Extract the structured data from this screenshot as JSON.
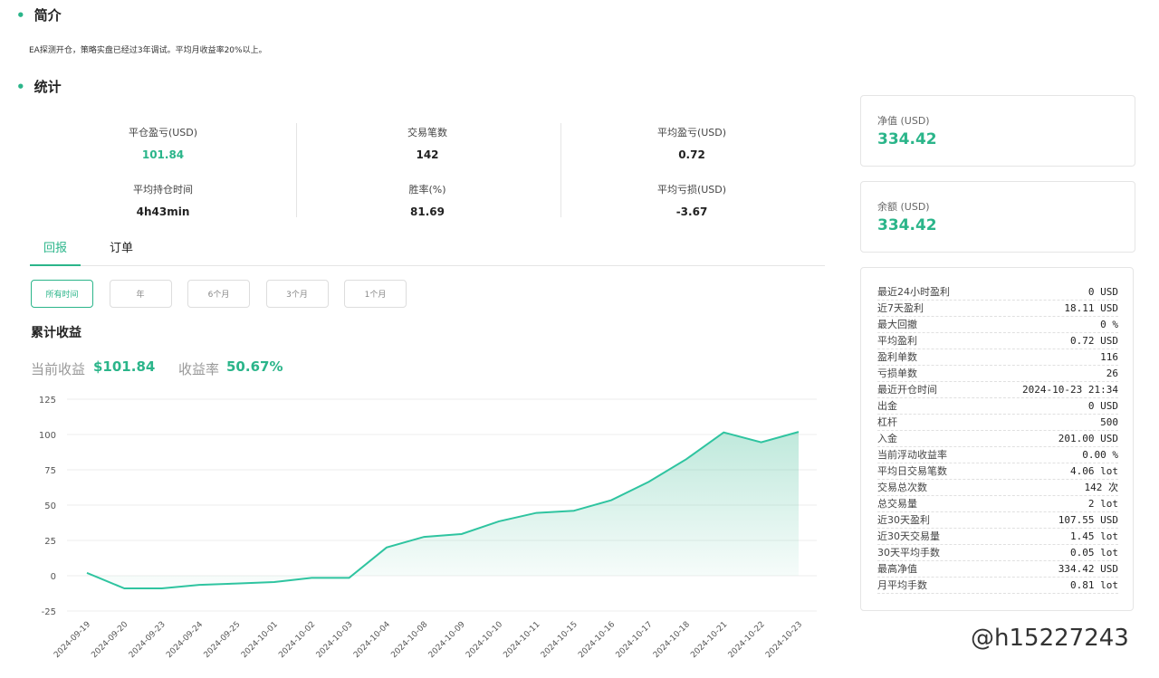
{
  "intro": {
    "title": "简介",
    "text": "EA探测开仓，策略实盘已经过3年调试。平均月收益率20%以上。"
  },
  "stats": {
    "title": "统计",
    "items": [
      {
        "label": "平仓盈亏(USD)",
        "value": "101.84",
        "green": true
      },
      {
        "label": "交易笔数",
        "value": "142"
      },
      {
        "label": "平均盈亏(USD)",
        "value": "0.72"
      },
      {
        "label": "平均持仓时间",
        "value": "4h43min"
      },
      {
        "label": "胜率(%)",
        "value": "81.69"
      },
      {
        "label": "平均亏损(USD)",
        "value": "-3.67"
      }
    ]
  },
  "tabs": [
    "回报",
    "订单"
  ],
  "ranges": [
    "所有时间",
    "年",
    "6个月",
    "3个月",
    "1个月"
  ],
  "chart_title": "累计收益",
  "summary": {
    "current_label": "当前收益",
    "current_value": "$101.84",
    "rate_label": "收益率",
    "rate_value": "50.67%"
  },
  "cards": [
    {
      "label": "净值 (USD)",
      "value": "334.42"
    },
    {
      "label": "余额 (USD)",
      "value": "334.42"
    }
  ],
  "details": [
    [
      "最近24小时盈利",
      "0 USD"
    ],
    [
      "近7天盈利",
      "18.11 USD"
    ],
    [
      "最大回撤",
      "0 %"
    ],
    [
      "平均盈利",
      "0.72 USD"
    ],
    [
      "盈利单数",
      "116"
    ],
    [
      "亏损单数",
      "26"
    ],
    [
      "最近开仓时间",
      "2024-10-23 21:34"
    ],
    [
      "出金",
      "0 USD"
    ],
    [
      "杠杆",
      "500"
    ],
    [
      "入金",
      "201.00 USD"
    ],
    [
      "当前浮动收益率",
      "0.00 %"
    ],
    [
      "平均日交易笔数",
      "4.06 lot"
    ],
    [
      "交易总次数",
      "142 次"
    ],
    [
      "总交易量",
      "2 lot"
    ],
    [
      "近30天盈利",
      "107.55 USD"
    ],
    [
      "近30天交易量",
      "1.45 lot"
    ],
    [
      "30天平均手数",
      "0.05 lot"
    ],
    [
      "最高净值",
      "334.42 USD"
    ],
    [
      "月平均手数",
      "0.81 lot"
    ]
  ],
  "watermark": "@h15227243",
  "colors": {
    "accent": "#2bb58a"
  },
  "chart_data": {
    "type": "area",
    "title": "累计收益",
    "ylim": [
      -25,
      125
    ],
    "yticks": [
      125,
      100,
      75,
      50,
      25,
      0,
      -25
    ],
    "x": [
      "2024-09-19",
      "2024-09-20",
      "2024-09-23",
      "2024-09-24",
      "2024-09-25",
      "2024-10-01",
      "2024-10-02",
      "2024-10-03",
      "2024-10-04",
      "2024-10-08",
      "2024-10-09",
      "2024-10-10",
      "2024-10-11",
      "2024-10-15",
      "2024-10-16",
      "2024-10-17",
      "2024-10-18",
      "2024-10-21",
      "2024-10-22",
      "2024-10-23"
    ],
    "values": [
      2,
      -9,
      -9,
      -6.5,
      -5.5,
      -4.5,
      -1.5,
      -1.5,
      20,
      27.5,
      29.5,
      38.5,
      44.5,
      46,
      53.5,
      66.5,
      82.5,
      101.5,
      94.5,
      101.84
    ]
  }
}
